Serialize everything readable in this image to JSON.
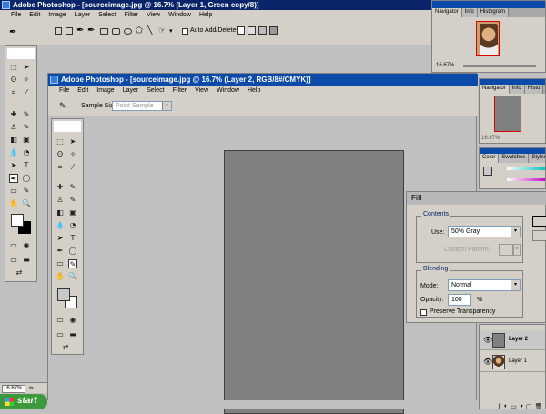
{
  "main_window": {
    "title": "Adobe Photoshop - [sourceimage.jpg @ 16.7% (Layer 1, Green copy/8)]",
    "menu": [
      "File",
      "Edit",
      "Image",
      "Layer",
      "Select",
      "Filter",
      "View",
      "Window",
      "Help"
    ],
    "options": {
      "auto_add_delete": "Auto Add/Delete"
    }
  },
  "inner_window": {
    "title": "Adobe Photoshop - [sourceimage.jpg @ 16.7% (Layer 2, RGB/8#/CMYK)]",
    "menu": [
      "File",
      "Edit",
      "Image",
      "Layer",
      "Select",
      "Filter",
      "View",
      "Window",
      "Help"
    ],
    "sample_size_label": "Sample Size:",
    "sample_size_value": "Point Sample"
  },
  "navigator_top": {
    "tabs": [
      "Navigator",
      "Info",
      "Histogram"
    ],
    "zoom": "16.67%"
  },
  "navigator_second": {
    "tabs": [
      "Navigator",
      "Info",
      "Histo"
    ],
    "zoom": "16.67%"
  },
  "color_palette": {
    "tabs": [
      "Color",
      "Swatches",
      "Styles"
    ]
  },
  "fill_dialog": {
    "title": "Fill",
    "contents_label": "Contents",
    "use_label": "Use:",
    "use_value": "50% Gray",
    "custom_pattern_label": "Custom Pattern:",
    "blending_label": "Blending",
    "mode_label": "Mode:",
    "mode_value": "Normal",
    "opacity_label": "Opacity:",
    "opacity_value": "100",
    "opacity_unit": "%",
    "preserve_transparency": "Preserve Transparency"
  },
  "layers": [
    {
      "name": "Layer 2"
    },
    {
      "name": "Layer 1"
    }
  ],
  "status": {
    "zoom": "16.67%"
  },
  "taskbar": {
    "start": "start"
  },
  "colors": {
    "canvas": "#808080",
    "title_active": "#0a246a",
    "taskbar_start": "#3c9a3c"
  }
}
